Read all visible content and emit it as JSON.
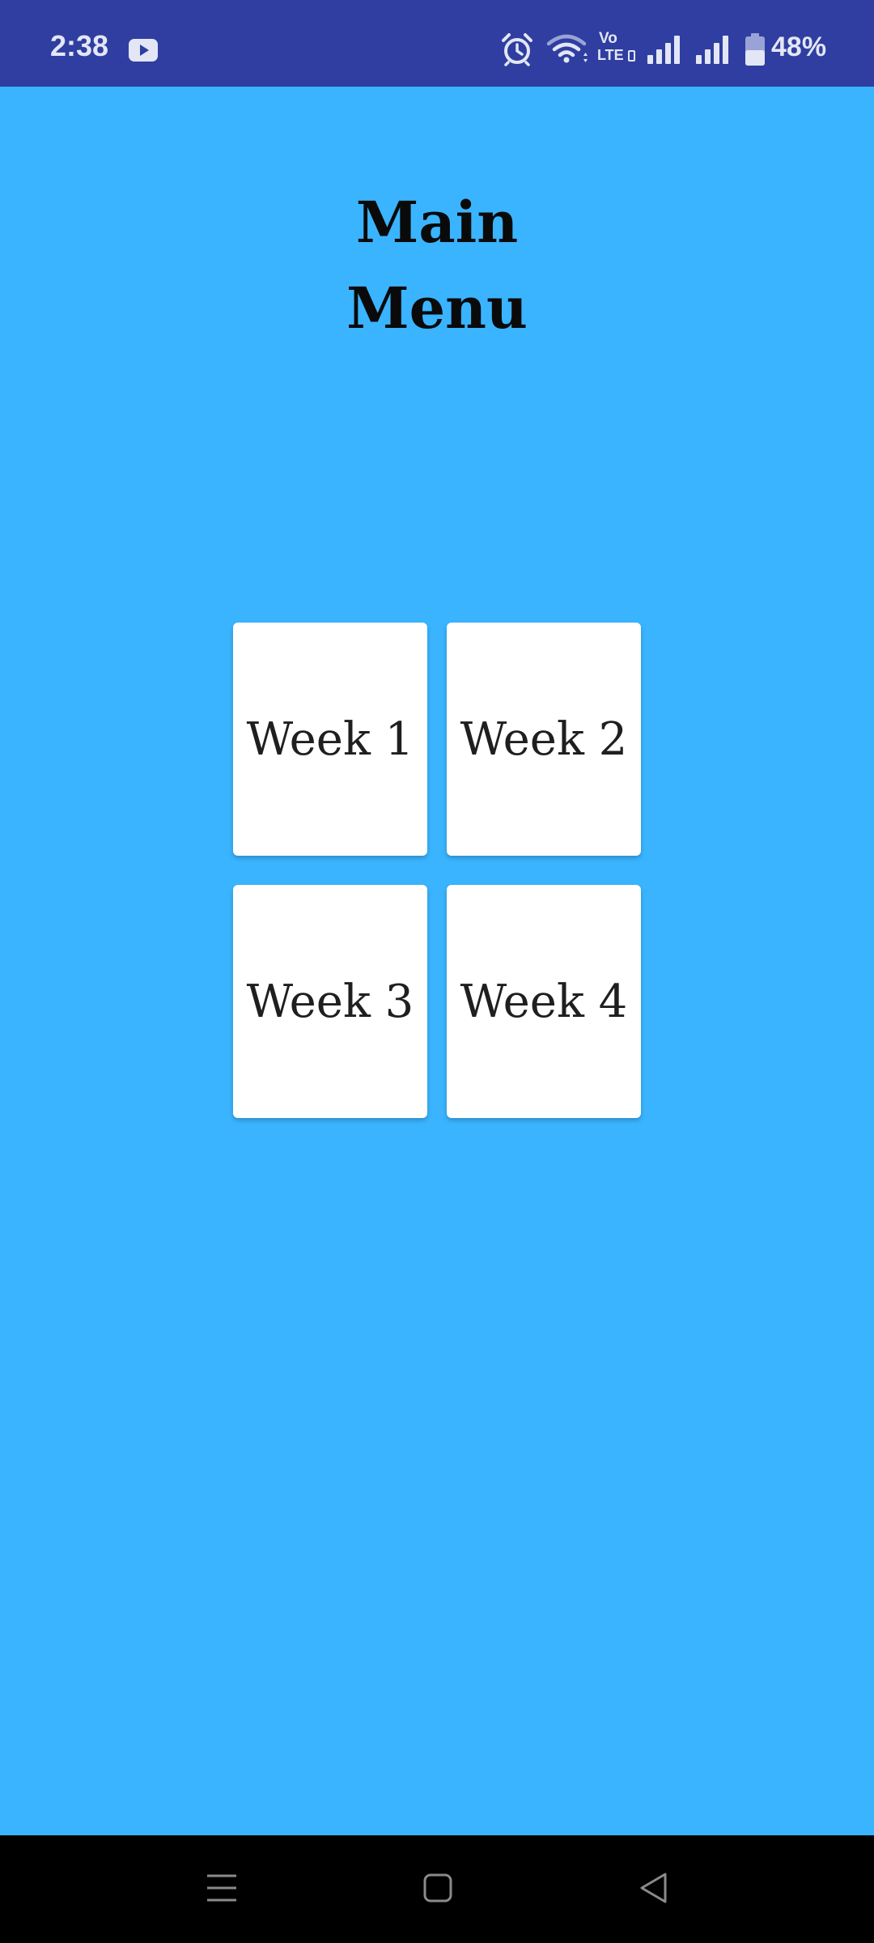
{
  "status_bar": {
    "time": "2:38",
    "battery_percent": "48%",
    "battery_level": 0.48,
    "icons": [
      "youtube-icon",
      "alarm-icon",
      "wifi-icon",
      "volte-icon",
      "signal-icon",
      "signal-icon",
      "battery-icon"
    ],
    "volte_top": "Vo",
    "volte_bottom": "LTE"
  },
  "title": {
    "line1": "Main",
    "line2": "Menu"
  },
  "weeks": [
    {
      "label": "Week 1"
    },
    {
      "label": "Week 2"
    },
    {
      "label": "Week 3"
    },
    {
      "label": "Week 4"
    }
  ],
  "nav_bar": {
    "icons": [
      "menu-icon",
      "home-icon",
      "back-icon"
    ]
  },
  "colors": {
    "background": "#3ab4ff",
    "status_bar": "#2f3ea0",
    "card": "#ffffff",
    "nav_bar": "#000000"
  }
}
